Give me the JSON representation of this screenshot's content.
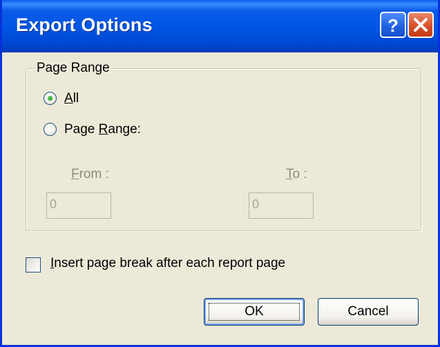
{
  "window": {
    "title": "Export Options"
  },
  "titlebar": {
    "help_label": "?",
    "close_label": "×"
  },
  "page_range": {
    "legend": "Page Range",
    "option_all": {
      "accel": "A",
      "rest": "ll",
      "checked": true
    },
    "option_range": {
      "pre": "Page ",
      "accel": "R",
      "rest": "ange:",
      "checked": false
    },
    "from": {
      "accel": "F",
      "rest": "rom :",
      "value": "0"
    },
    "to": {
      "accel": "T",
      "rest": "o :",
      "value": "0"
    }
  },
  "insert_break": {
    "accel": "I",
    "rest": "nsert page break after each report page",
    "checked": false
  },
  "buttons": {
    "ok": "OK",
    "cancel": "Cancel"
  }
}
